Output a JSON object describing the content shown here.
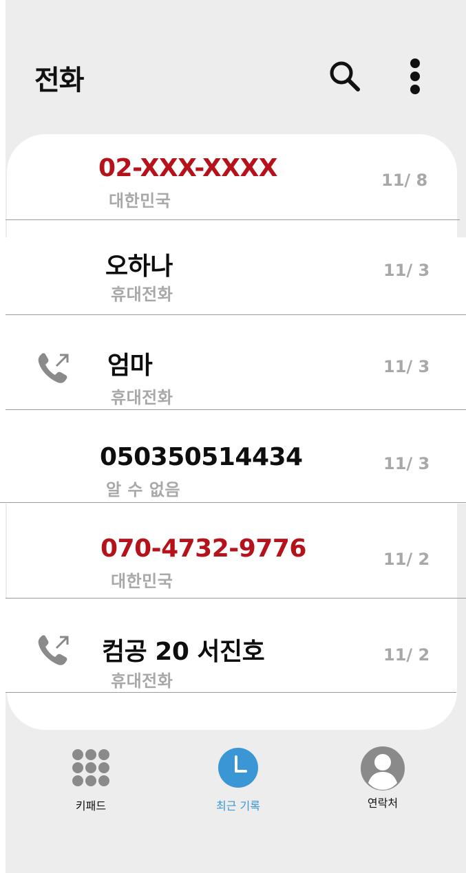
{
  "header": {
    "title": "전화",
    "search_icon": "search-icon",
    "more_icon": "more-vertical-icon"
  },
  "calls": [
    {
      "name": "02-XXX-XXXX",
      "sub": "대한민국",
      "date": "11/ 8",
      "name_color": "#b5121b",
      "icon": null
    },
    {
      "name": "오하나",
      "sub": "휴대전화",
      "date": "11/ 3",
      "name_color": "#0e0e0e",
      "icon": null
    },
    {
      "name": "엄마",
      "sub": "휴대전화",
      "date": "11/ 3",
      "name_color": "#0e0e0e",
      "icon": "outgoing-call-icon"
    },
    {
      "name": "050350514434",
      "sub": "알 수 없음",
      "date": "11/ 3",
      "name_color": "#0e0e0e",
      "icon": null
    },
    {
      "name": "070-4732-9776",
      "sub": "대한민국",
      "date": "11/ 2",
      "name_color": "#b5121b",
      "icon": null
    },
    {
      "name": "컴공 20 서진호",
      "sub": "휴대전화",
      "date": "11/ 2",
      "name_color": "#0e0e0e",
      "icon": "outgoing-call-icon"
    }
  ],
  "bottom_nav": [
    {
      "label": "키패드",
      "icon": "keypad-icon",
      "active": false
    },
    {
      "label": "최근 기록",
      "icon": "clock-icon",
      "active": true
    },
    {
      "label": "연락처",
      "icon": "contacts-icon",
      "active": false
    }
  ],
  "colors": {
    "background": "#ededed",
    "accent": "#3a96d4",
    "missed_red": "#b5121b",
    "secondary_text": "#a8a8a8",
    "icon_gray": "#8a8a8a"
  }
}
